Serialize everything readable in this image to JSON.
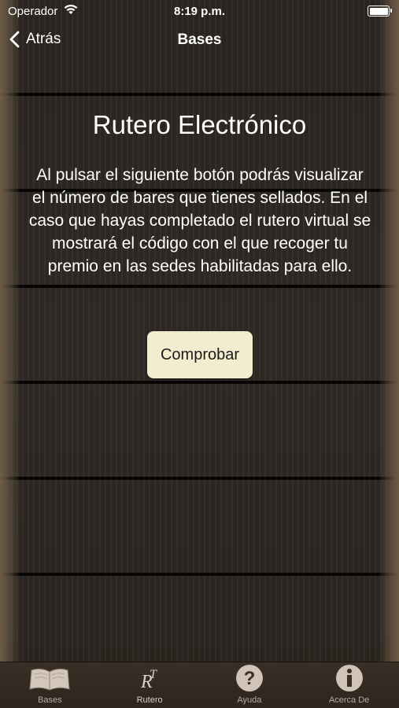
{
  "status_bar": {
    "carrier": "Operador",
    "time": "8:19 p.m."
  },
  "nav": {
    "back_label": "Atrás",
    "title": "Bases"
  },
  "content": {
    "heading": "Rutero Electrónico",
    "body": "Al pulsar el siguiente botón podrás visualizar el número de bares que tienes sellados. En el caso que hayas completado el rutero virtual se mostrará el código con el que recoger tu premio en las sedes habilitadas para ello.",
    "button_label": "Comprobar"
  },
  "tabs": [
    {
      "label": "Bases",
      "icon": "book-icon"
    },
    {
      "label": "Rutero",
      "icon": "rutero-logo-icon",
      "active": true
    },
    {
      "label": "Ayuda",
      "icon": "question-icon"
    },
    {
      "label": "Acerca De",
      "icon": "info-icon"
    }
  ],
  "colors": {
    "button_bg": "#f4ecce",
    "tabbar_bg": "#2e251e",
    "wood_dark": "#2b2621"
  }
}
